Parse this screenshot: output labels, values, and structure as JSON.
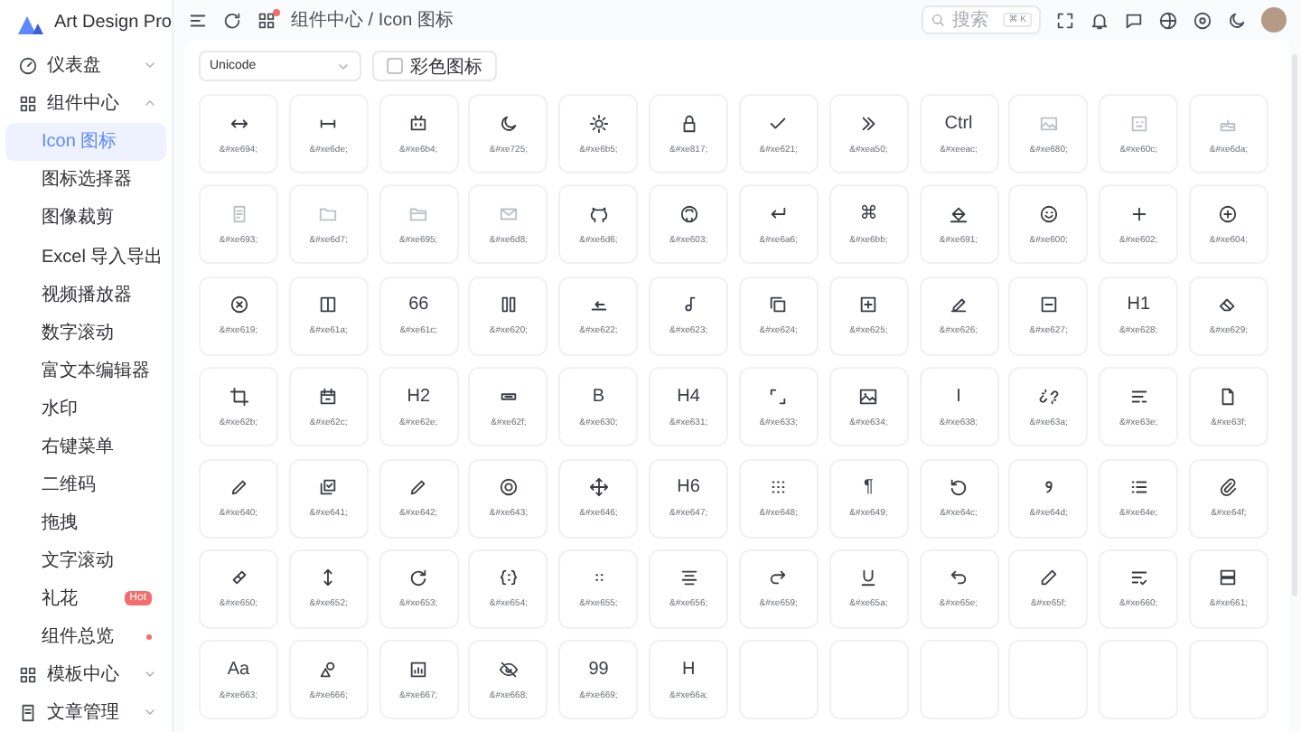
{
  "app": {
    "logo_text": "Art Design Pro"
  },
  "sidebar": {
    "items": [
      {
        "label": "仪表盘",
        "expanded": false
      },
      {
        "label": "组件中心",
        "expanded": true,
        "children": [
          {
            "label": "Icon 图标",
            "selected": true,
            "dot": false
          },
          {
            "label": "图标选择器",
            "selected": false,
            "dot": false
          },
          {
            "label": "图像裁剪",
            "selected": false,
            "dot": false
          },
          {
            "label": "Excel 导入导出",
            "selected": false,
            "dot": false
          },
          {
            "label": "视频播放器",
            "selected": false,
            "dot": false
          },
          {
            "label": "数字滚动",
            "selected": false,
            "dot": false
          },
          {
            "label": "富文本编辑器",
            "selected": false,
            "dot": false
          },
          {
            "label": "水印",
            "selected": false,
            "dot": false
          },
          {
            "label": "右键菜单",
            "selected": false,
            "dot": false
          },
          {
            "label": "二维码",
            "selected": false,
            "dot": false
          },
          {
            "label": "拖拽",
            "selected": false,
            "dot": false
          },
          {
            "label": "文字滚动",
            "selected": false,
            "dot": false
          },
          {
            "label": "礼花",
            "selected": false,
            "dot": false,
            "badge": "Hot"
          },
          {
            "label": "组件总览",
            "selected": false,
            "dot": true
          }
        ]
      },
      {
        "label": "模板中心",
        "expanded": false
      },
      {
        "label": "文章管理",
        "expanded": false
      }
    ]
  },
  "header": {
    "breadcrumb": "组件中心 / Icon 图标",
    "apps_dot": true,
    "search": {
      "placeholder": "搜索",
      "shortcut": "⌘ K"
    }
  },
  "filters": {
    "type_select": {
      "value": "Unicode"
    },
    "color_checkbox": {
      "label": "彩色图标",
      "checked": false
    }
  },
  "icons": [
    {
      "kind": "icon",
      "code": "&#xe694;"
    },
    {
      "kind": "icon",
      "code": "&#xe6de;"
    },
    {
      "kind": "icon",
      "code": "&#xe6b4;"
    },
    {
      "kind": "icon",
      "code": "&#xe725;"
    },
    {
      "kind": "icon",
      "code": "&#xe6b5;"
    },
    {
      "kind": "icon",
      "code": "&#xe817;"
    },
    {
      "kind": "icon",
      "code": "&#xe621;"
    },
    {
      "kind": "icon",
      "code": "&#xea50;"
    },
    {
      "kind": "glyph",
      "glyph": "Ctrl",
      "code": "&#xeeac;"
    },
    {
      "kind": "light_icon",
      "code": "&#xe680;"
    },
    {
      "kind": "light_icon",
      "code": "&#xe60c;"
    },
    {
      "kind": "light_icon",
      "code": "&#xe6da;"
    },
    {
      "kind": "light_icon",
      "code": "&#xe693;"
    },
    {
      "kind": "light_icon",
      "code": "&#xe6d7;"
    },
    {
      "kind": "light_icon",
      "code": "&#xe695;"
    },
    {
      "kind": "light_icon",
      "code": "&#xe6d8;"
    },
    {
      "kind": "icon",
      "code": "&#xe6d6;"
    },
    {
      "kind": "icon",
      "code": "&#xe603;"
    },
    {
      "kind": "icon",
      "code": "&#xe6a6;"
    },
    {
      "kind": "glyph",
      "glyph": "⌘",
      "code": "&#xe6bb;"
    },
    {
      "kind": "icon",
      "code": "&#xe691;"
    },
    {
      "kind": "icon",
      "code": "&#xe600;"
    },
    {
      "kind": "icon",
      "code": "&#xe602;"
    },
    {
      "kind": "icon",
      "code": "&#xe604;"
    },
    {
      "kind": "icon",
      "code": "&#xe619;"
    },
    {
      "kind": "icon",
      "code": "&#xe61a;"
    },
    {
      "kind": "glyph",
      "glyph": "66",
      "code": "&#xe61c;"
    },
    {
      "kind": "icon",
      "code": "&#xe620;"
    },
    {
      "kind": "icon",
      "code": "&#xe622;"
    },
    {
      "kind": "icon",
      "code": "&#xe623;"
    },
    {
      "kind": "icon",
      "code": "&#xe624;"
    },
    {
      "kind": "icon",
      "code": "&#xe625;"
    },
    {
      "kind": "icon",
      "code": "&#xe626;"
    },
    {
      "kind": "icon",
      "code": "&#xe627;"
    },
    {
      "kind": "glyph",
      "glyph": "H1",
      "code": "&#xe628;"
    },
    {
      "kind": "icon",
      "code": "&#xe629;"
    },
    {
      "kind": "icon",
      "code": "&#xe62b;"
    },
    {
      "kind": "icon",
      "code": "&#xe62c;"
    },
    {
      "kind": "glyph",
      "glyph": "H2",
      "code": "&#xe62e;"
    },
    {
      "kind": "icon",
      "code": "&#xe62f;"
    },
    {
      "kind": "glyph",
      "glyph": "B",
      "code": "&#xe630;"
    },
    {
      "kind": "glyph",
      "glyph": "H4",
      "code": "&#xe631;"
    },
    {
      "kind": "icon",
      "code": "&#xe633;"
    },
    {
      "kind": "icon",
      "code": "&#xe634;"
    },
    {
      "kind": "glyph",
      "glyph": "I",
      "code": "&#xe638;"
    },
    {
      "kind": "icon",
      "code": "&#xe63a;"
    },
    {
      "kind": "icon",
      "code": "&#xe63e;"
    },
    {
      "kind": "icon",
      "code": "&#xe63f;"
    },
    {
      "kind": "icon",
      "code": "&#xe640;"
    },
    {
      "kind": "icon",
      "code": "&#xe641;"
    },
    {
      "kind": "icon",
      "code": "&#xe642;"
    },
    {
      "kind": "icon",
      "code": "&#xe643;"
    },
    {
      "kind": "icon",
      "code": "&#xe646;"
    },
    {
      "kind": "glyph",
      "glyph": "H6",
      "code": "&#xe647;"
    },
    {
      "kind": "icon",
      "code": "&#xe648;"
    },
    {
      "kind": "glyph",
      "glyph": "¶",
      "code": "&#xe649;"
    },
    {
      "kind": "icon",
      "code": "&#xe64c;"
    },
    {
      "kind": "icon",
      "code": "&#xe64d;"
    },
    {
      "kind": "icon",
      "code": "&#xe64e;"
    },
    {
      "kind": "icon",
      "code": "&#xe64f;"
    },
    {
      "kind": "icon",
      "code": "&#xe650;"
    },
    {
      "kind": "icon",
      "code": "&#xe652;"
    },
    {
      "kind": "icon",
      "code": "&#xe653;"
    },
    {
      "kind": "icon",
      "code": "&#xe654;"
    },
    {
      "kind": "icon",
      "code": "&#xe655;"
    },
    {
      "kind": "icon",
      "code": "&#xe656;"
    },
    {
      "kind": "icon",
      "code": "&#xe659;"
    },
    {
      "kind": "icon",
      "code": "&#xe65a;"
    },
    {
      "kind": "icon",
      "code": "&#xe65e;"
    },
    {
      "kind": "icon",
      "code": "&#xe65f;"
    },
    {
      "kind": "icon",
      "code": "&#xe660;"
    },
    {
      "kind": "icon",
      "code": "&#xe661;"
    },
    {
      "kind": "glyph",
      "glyph": "Aa",
      "code": "&#xe663;"
    },
    {
      "kind": "icon",
      "code": "&#xe666;"
    },
    {
      "kind": "icon",
      "code": "&#xe667;"
    },
    {
      "kind": "icon",
      "code": "&#xe668;"
    },
    {
      "kind": "glyph",
      "glyph": "99",
      "code": "&#xe669;"
    },
    {
      "kind": "glyph",
      "glyph": "H",
      "code": "&#xe66a;"
    }
  ]
}
